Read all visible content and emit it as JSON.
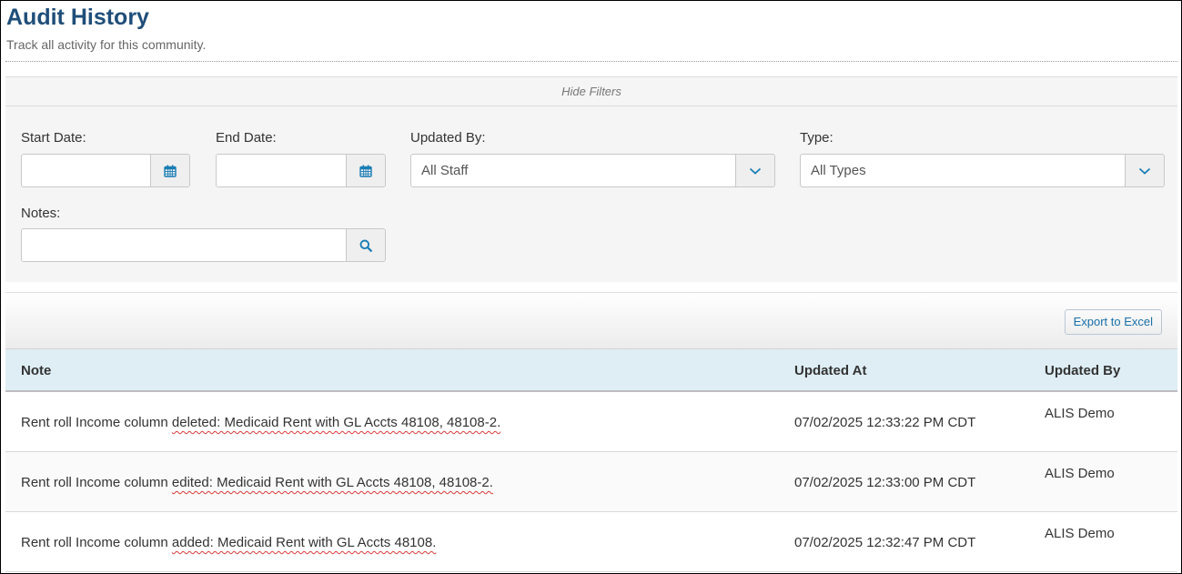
{
  "header": {
    "title": "Audit History",
    "subtitle": "Track all activity for this community."
  },
  "filters": {
    "toggle_label": "Hide Filters",
    "start_date": {
      "label": "Start Date:",
      "value": ""
    },
    "end_date": {
      "label": "End Date:",
      "value": ""
    },
    "updated_by": {
      "label": "Updated By:",
      "selected": "All Staff"
    },
    "type": {
      "label": "Type:",
      "selected": "All Types"
    },
    "notes": {
      "label": "Notes:",
      "value": ""
    }
  },
  "toolbar": {
    "export_label": "Export to Excel"
  },
  "table": {
    "columns": [
      "Note",
      "Updated At",
      "Updated By"
    ],
    "rows": [
      {
        "note_prefix": "Rent roll Income column ",
        "note_rest": "deleted: Medicaid Rent with GL Accts 48108, 48108-2.",
        "updated_at": "07/02/2025 12:33:22 PM CDT",
        "updated_by": "ALIS Demo"
      },
      {
        "note_prefix": "Rent roll Income column ",
        "note_rest": "edited: Medicaid Rent with GL Accts 48108, 48108-2.",
        "updated_at": "07/02/2025 12:33:00 PM CDT",
        "updated_by": "ALIS Demo"
      },
      {
        "note_prefix": "Rent roll Income column ",
        "note_rest": "added: Medicaid Rent with GL Accts 48108.",
        "updated_at": "07/02/2025 12:32:47 PM CDT",
        "updated_by": "ALIS Demo"
      }
    ]
  },
  "icons": {
    "calendar": "calendar-icon",
    "chevron": "chevron-down-icon",
    "search": "search-icon"
  },
  "colors": {
    "title": "#1f4e79",
    "icon_accent": "#1a7db5",
    "header_row": "#dfeef5",
    "spellcheck": "#d9393a"
  }
}
